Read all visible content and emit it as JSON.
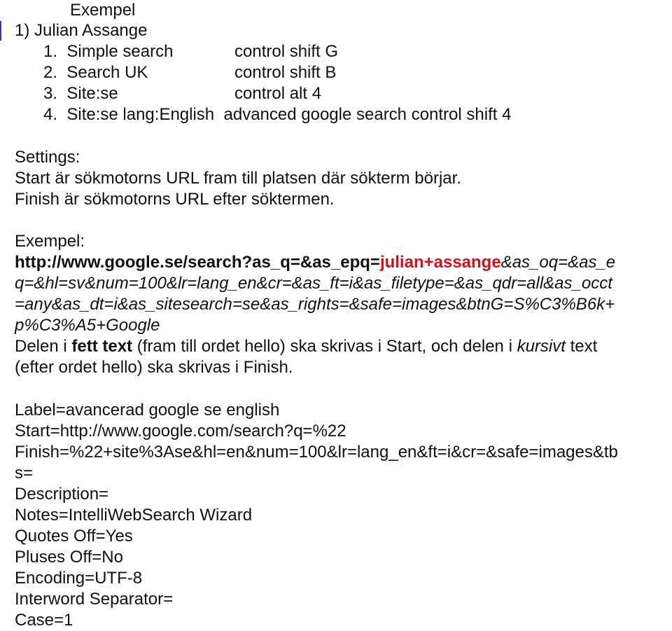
{
  "header": {
    "title": "Exempel",
    "subtitle": "1) Julian Assange"
  },
  "shortcuts": [
    {
      "num": "1.",
      "label": "Simple search",
      "keys": "control shift G"
    },
    {
      "num": "2.",
      "label": "Search UK",
      "keys": "control shift B"
    },
    {
      "num": "3.",
      "label": "Site:se",
      "keys": "control alt 4"
    },
    {
      "num": "4.",
      "label": "Site:se lang:English",
      "keys": "advanced google search control shift 4"
    }
  ],
  "settings": {
    "title": "Settings:",
    "start_desc": "Start är sökmotorns URL fram till platsen där sökterm börjar.",
    "finish_desc": "Finish är sökmotorns URL efter söktermen."
  },
  "example": {
    "title": "Exempel:",
    "url_bold": "http://www.google.se/search?as_q=&as_epq=",
    "url_term": "julian+assange",
    "url_italic_1": "&as_oq=&as_e",
    "url_italic_2": "q=&hl=sv&num=100&lr=lang_en&cr=&as_ft=i&as_filetype=&as_qdr=all&as_occt",
    "url_italic_3": "=any&as_dt=i&as_sitesearch=se&as_rights=&safe=images&btnG=S%C3%B6k+",
    "url_italic_4": "p%C3%A5+Google",
    "explain_1": "Delen i ",
    "explain_bold": "fett text",
    "explain_2": " (fram till ordet hello) ska skrivas i Start, och delen i ",
    "explain_italic": "kursivt",
    "explain_3": " text",
    "explain_4": "(efter ordet hello) ska skrivas i Finish."
  },
  "config": [
    "Label=avancerad google se english",
    "Start=http://www.google.com/search?q=%22",
    "Finish=%22+site%3Ase&hl=en&num=100&lr=lang_en&ft=i&cr=&safe=images&tb",
    "s=",
    "Description=",
    "Notes=IntelliWebSearch Wizard",
    "Quotes Off=Yes",
    "Pluses Off=No",
    "Encoding=UTF-8",
    "Interword Separator=",
    "Case=1"
  ]
}
